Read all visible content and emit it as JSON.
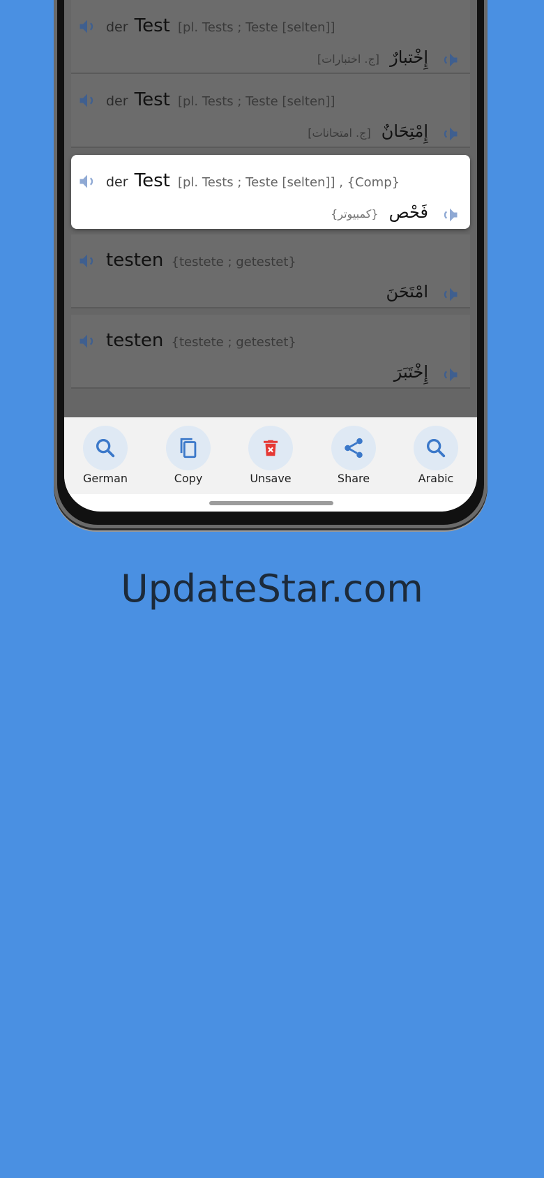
{
  "entries": [
    {
      "article": "der",
      "word": "Test",
      "grammar": "[pl.  Tests ; Teste [selten]]",
      "arabic": "إِخْتبارٌ",
      "arabic_grammar": "[ج. اختبارات]"
    },
    {
      "article": "der",
      "word": "Test",
      "grammar": "[pl.  Tests ; Teste [selten]]",
      "arabic": "إِمْتِحَانٌ",
      "arabic_grammar": "[ج. امتحانات]"
    },
    {
      "article": "der",
      "word": "Test",
      "grammar": "[pl.  Tests ; Teste [selten]] ,  {Comp}",
      "arabic": "فَحْص",
      "arabic_grammar": "{كمبيوتر}"
    },
    {
      "article": "",
      "word": "testen",
      "grammar": "{testete ; getestet}",
      "arabic": "امْتَحَنَ",
      "arabic_grammar": ""
    },
    {
      "article": "",
      "word": "testen",
      "grammar": "{testete ; getestet}",
      "arabic": "إِخْتَبَرَ",
      "arabic_grammar": ""
    }
  ],
  "toolbar": [
    {
      "label": "German",
      "icon": "search-icon",
      "color": "#3b78c9"
    },
    {
      "label": "Copy",
      "icon": "copy-icon",
      "color": "#3b78c9"
    },
    {
      "label": "Unsave",
      "icon": "trash-icon",
      "color": "#e53935"
    },
    {
      "label": "Share",
      "icon": "share-icon",
      "color": "#3b78c9"
    },
    {
      "label": "Arabic",
      "icon": "search-icon",
      "color": "#3b78c9"
    }
  ],
  "brand": "UpdateStar.com",
  "colors": {
    "background": "#4a90e2",
    "accent": "#3b78c9",
    "danger": "#e53935"
  }
}
